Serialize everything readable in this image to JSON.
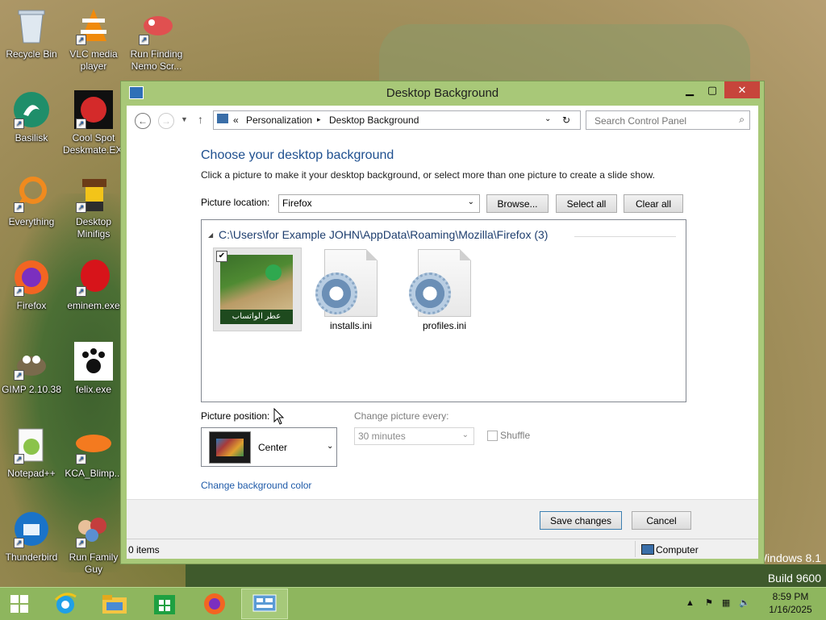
{
  "desktop": {
    "icons": [
      {
        "label": "Recycle Bin",
        "icon": "recycle-bin-icon"
      },
      {
        "label": "VLC media player",
        "icon": "vlc-icon"
      },
      {
        "label": "Run Finding Nemo Scr...",
        "icon": "finding-nemo-icon"
      },
      {
        "label": "Basilisk",
        "icon": "basilisk-icon"
      },
      {
        "label": "Cool Spot Deskmate.EXE",
        "icon": "cool-spot-icon"
      },
      {
        "label": "Everything",
        "icon": "everything-icon"
      },
      {
        "label": "Desktop Minifigs",
        "icon": "minifigs-icon"
      },
      {
        "label": "Firefox",
        "icon": "firefox-icon"
      },
      {
        "label": "eminem.exe",
        "icon": "eminem-icon"
      },
      {
        "label": "GIMP 2.10.38",
        "icon": "gimp-icon"
      },
      {
        "label": "felix.exe",
        "icon": "felix-icon"
      },
      {
        "label": "Notepad++",
        "icon": "notepad-plus-plus-icon"
      },
      {
        "label": "KCA_Blimp...",
        "icon": "kca-blimp-icon"
      },
      {
        "label": "Thunderbird",
        "icon": "thunderbird-icon"
      },
      {
        "label": "Run Family Guy",
        "icon": "family-guy-icon"
      }
    ],
    "watermark": {
      "line1": "Windows 8.1",
      "line2": "Build 9600"
    }
  },
  "window": {
    "title": "Desktop Background",
    "address": {
      "overflow": "«",
      "crumb1": "Personalization",
      "sep": "▸",
      "crumb2": "Desktop Background"
    },
    "search_placeholder": "Search Control Panel",
    "heading": "Choose your desktop background",
    "subtext": "Click a picture to make it your desktop background, or select more than one picture to create a slide show.",
    "picture_location_label": "Picture location:",
    "picture_location_value": "Firefox",
    "browse_label": "Browse...",
    "select_all_label": "Select all",
    "clear_all_label": "Clear all",
    "group_header": "C:\\Users\\for Example JOHN\\AppData\\Roaming\\Mozilla\\Firefox (3)",
    "thumbnail_caption": "عطر الواتساب",
    "files": [
      {
        "name": "installs.ini"
      },
      {
        "name": "profiles.ini"
      }
    ],
    "picture_position_label": "Picture position:",
    "picture_position_value": "Center",
    "change_every_label": "Change picture every:",
    "change_every_value": "30 minutes",
    "shuffle_label": "Shuffle",
    "change_bg_color_link": "Change background color",
    "save_label": "Save changes",
    "cancel_label": "Cancel",
    "status_items": "0 items",
    "status_location": "Computer"
  },
  "taskbar": {
    "clock_time": "8:59 PM",
    "clock_date": "1/16/2025"
  },
  "colors": {
    "accent": "#a8c878",
    "taskbar": "#8eb65e",
    "close": "#c7453b",
    "link": "#1e5aa8"
  }
}
